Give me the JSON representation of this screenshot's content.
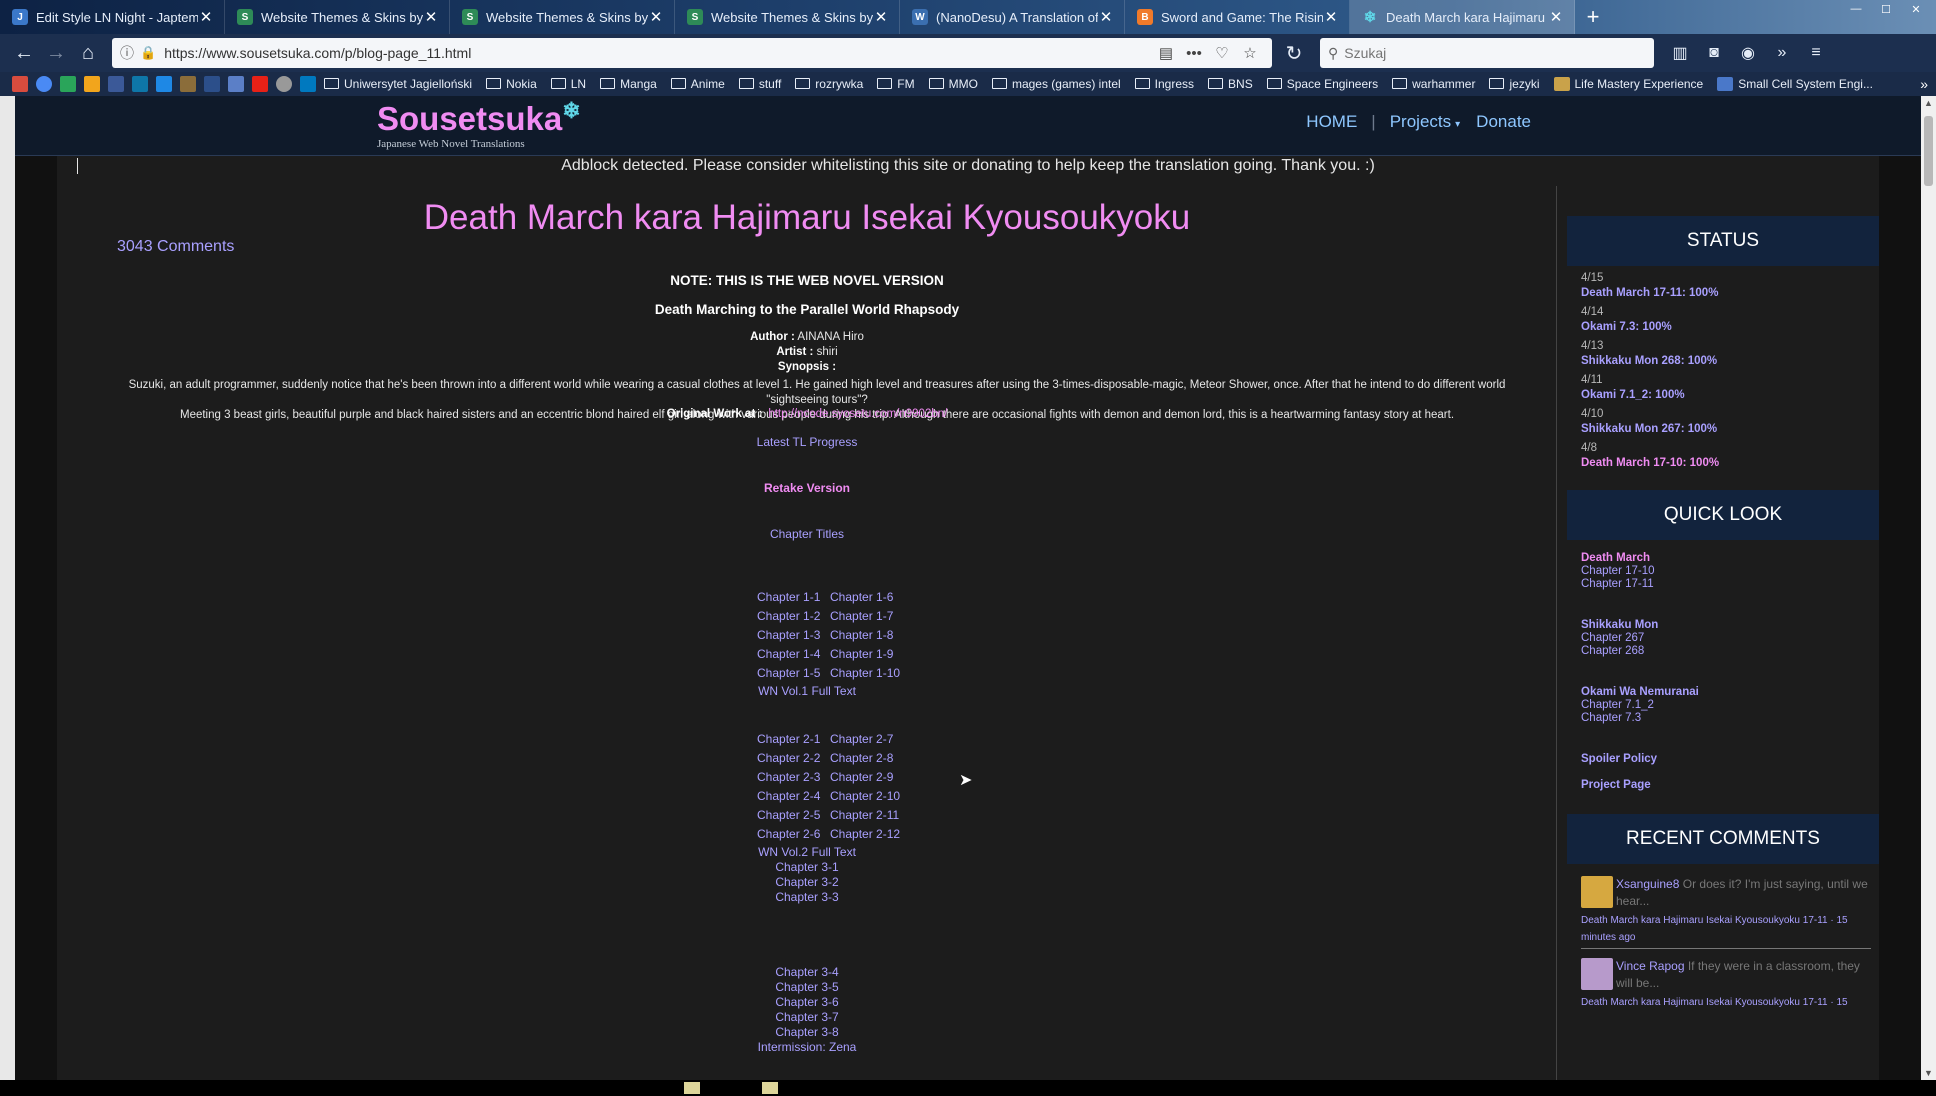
{
  "browser": {
    "tabs": [
      {
        "label": "Edit Style LN Night - Japtem",
        "icon_color": "#3b78c9",
        "active": false
      },
      {
        "label": "Website Themes & Skins by Styl",
        "icon_color": "#2e8b57",
        "active": false
      },
      {
        "label": "Website Themes & Skins by Styl",
        "icon_color": "#2e8b57",
        "active": false
      },
      {
        "label": "Website Themes & Skins by Styl",
        "icon_color": "#2e8b57",
        "active": false
      },
      {
        "label": "(NanoDesu) A Translation of th",
        "icon_color": "#3b6fb0",
        "active": false
      },
      {
        "label": "Sword and Game: The Rising of",
        "icon_color": "#f07a2a",
        "active": false
      },
      {
        "label": "Death March kara Hajimaru Ise",
        "icon_color": "#5fd7e8",
        "active": true
      }
    ],
    "url": "https://www.sousetsuka.com/p/blog-page_11.html",
    "search_placeholder": "Szukaj",
    "bookmarks": [
      "Uniwersytet Jagielloński",
      "Nokia",
      "LN",
      "Manga",
      "Anime",
      "stuff",
      "rozrywka",
      "FM",
      "MMO",
      "mages (games) intel",
      "Ingress",
      "BNS",
      "Space Engineers",
      "warhammer",
      "jezyki",
      "Life Mastery Experience",
      "Small Cell System Engi..."
    ]
  },
  "site": {
    "logo": "Sousetsuka",
    "tagline": "Japanese Web Novel Translations",
    "nav": {
      "home": "HOME",
      "projects": "Projects",
      "donate": "Donate"
    },
    "adblock": "Adblock detected. Please consider whitelisting this site or donating to help keep the translation going. Thank you. :)"
  },
  "post": {
    "title": "Death March kara Hajimaru Isekai Kyousoukyoku",
    "comments": "3043 Comments",
    "note": "NOTE: THIS IS THE WEB NOVEL VERSION",
    "subtitle": "Death Marching to the Parallel World Rhapsody",
    "author_label": "Author :",
    "author": "AINANA Hiro",
    "artist_label": "Artist :",
    "artist": "shiri",
    "synopsis_label": "Synopsis :",
    "synopsis_1": "Suzuki, an adult programmer, suddenly notice that he's been thrown into a different world while wearing a casual clothes at level 1. He gained high level and treasures after using the 3-times-disposable-magic, Meteor Shower, once. After that he intend to do different world \"sightseeing tours\"?",
    "synopsis_2": "Meeting 3 beast girls, beautiful purple and black haired sisters and an eccentric blond haired elf girl along with various people during his trip. Although there are occasional fights with demon and demon lord, this is a heartwarming fantasy story at heart.",
    "original_label": "Original Work at :",
    "original_link": "http://ncode.syosetu.com/n9902bn/",
    "latest": "Latest TL Progress",
    "retake": "Retake Version",
    "chapter_titles": "Chapter Titles",
    "vol1_rows": [
      [
        "Chapter 1-1",
        "Chapter 1-6"
      ],
      [
        "Chapter 1-2",
        "Chapter 1-7"
      ],
      [
        "Chapter 1-3",
        "Chapter 1-8"
      ],
      [
        "Chapter 1-4",
        "Chapter 1-9"
      ],
      [
        "Chapter 1-5",
        "Chapter 1-10"
      ]
    ],
    "vol1_full": "WN Vol.1 Full Text",
    "vol2_rows": [
      [
        "Chapter 2-1",
        "Chapter 2-7"
      ],
      [
        "Chapter 2-2",
        "Chapter 2-8"
      ],
      [
        "Chapter 2-3",
        "Chapter 2-9"
      ],
      [
        "Chapter 2-4",
        "Chapter 2-10"
      ],
      [
        "Chapter 2-5",
        "Chapter 2-11"
      ],
      [
        "Chapter 2-6",
        "Chapter 2-12"
      ]
    ],
    "vol2_full": "WN Vol.2 Full Text",
    "vol3_a": [
      "Chapter 3-1",
      "Chapter 3-2",
      "Chapter 3-3"
    ],
    "vol3_b": [
      "Chapter 3-4",
      "Chapter 3-5",
      "Chapter 3-6",
      "Chapter 3-7",
      "Chapter 3-8",
      "Intermission: Zena"
    ]
  },
  "sidebar": {
    "status_title": "STATUS",
    "status": [
      {
        "date": "4/15",
        "text": "Death March 17-11: 100%"
      },
      {
        "date": "4/14",
        "text": "Okami 7.3: 100%"
      },
      {
        "date": "4/13",
        "text": "Shikkaku Mon 268: 100%"
      },
      {
        "date": "4/11",
        "text": "Okami 7.1_2: 100%"
      },
      {
        "date": "4/10",
        "text": "Shikkaku Mon 267: 100%"
      },
      {
        "date": "4/8",
        "text": "Death March 17-10: 100%"
      }
    ],
    "quick_title": "QUICK LOOK",
    "quick": [
      {
        "title": "Death March",
        "items": [
          "Chapter 17-10",
          "Chapter 17-11"
        ]
      },
      {
        "title": "Shikkaku Mon",
        "items": [
          "Chapter 267",
          "Chapter 268"
        ]
      },
      {
        "title": "Okami Wa Nemuranai",
        "items": [
          "Chapter 7.1_2",
          "Chapter 7.3"
        ]
      }
    ],
    "spoiler": "Spoiler Policy",
    "project_page": "Project Page",
    "recent_title": "RECENT COMMENTS",
    "recent": [
      {
        "name": "Xsanguine8",
        "text": "Or does it? I'm just saying, until we hear...",
        "where": "Death March kara Hajimaru Isekai Kyousoukyoku 17-11 · 15 minutes ago"
      },
      {
        "name": "Vince Rapog",
        "text": "If they were in a classroom, they will be...",
        "where": "Death March kara Hajimaru Isekai Kyousoukyoku 17-11 · 15"
      }
    ]
  }
}
